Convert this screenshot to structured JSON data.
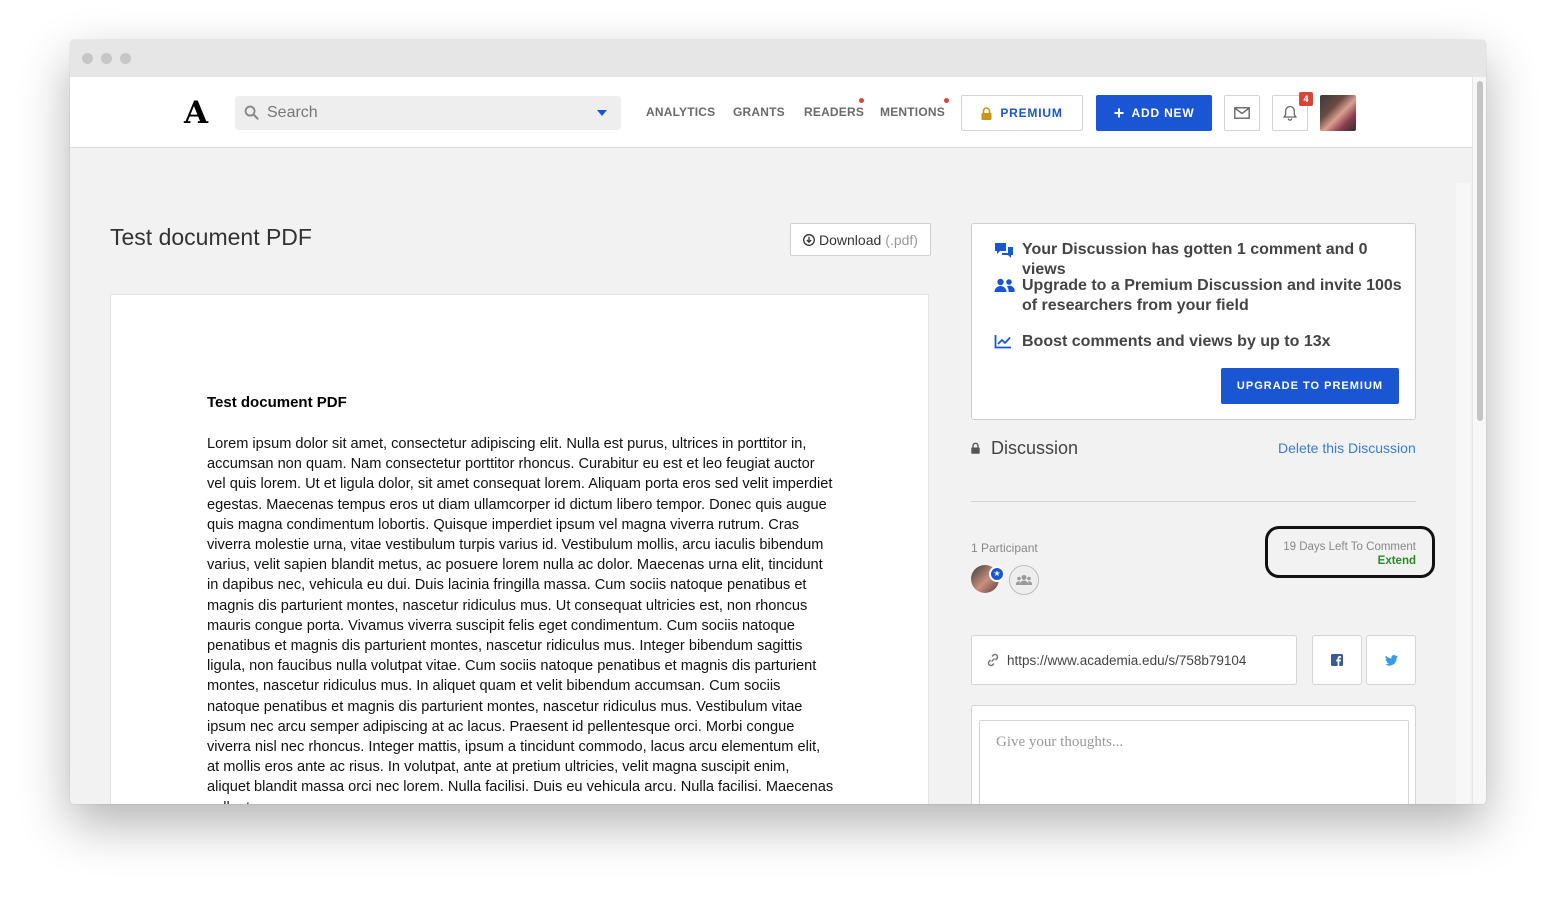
{
  "nav": {
    "logo": "A",
    "search_placeholder": "Search",
    "links": {
      "analytics": "ANALYTICS",
      "grants": "GRANTS",
      "readers": "READERS",
      "mentions": "MENTIONS"
    },
    "premium_label": "PREMIUM",
    "add_new_label": "ADD NEW",
    "notifications_count": "4",
    "accent_color": "#1a56d3",
    "alert_color": "#d6453a"
  },
  "document": {
    "title": "Test document PDF",
    "download_label": "Download",
    "download_ext": "(.pdf)",
    "page_heading": "Test document PDF",
    "page_body": "Lorem ipsum dolor sit amet, consectetur adipiscing elit. Nulla est purus, ultrices in porttitor in, accumsan non quam. Nam consectetur porttitor rhoncus. Curabitur eu est et leo feugiat auctor vel quis lorem. Ut et ligula dolor, sit amet consequat lorem. Aliquam porta eros sed velit imperdiet egestas. Maecenas tempus eros ut diam ullamcorper id dictum libero tempor. Donec quis augue quis magna condimentum lobortis. Quisque imperdiet ipsum vel magna viverra rutrum. Cras viverra molestie urna, vitae vestibulum turpis varius id. Vestibulum mollis, arcu iaculis bibendum varius, velit sapien blandit metus, ac posuere lorem nulla ac dolor. Maecenas urna elit, tincidunt in dapibus nec, vehicula eu dui. Duis lacinia fringilla massa. Cum sociis natoque penatibus et magnis dis parturient montes, nascetur ridiculus mus. Ut consequat ultricies est, non rhoncus mauris congue porta. Vivamus viverra suscipit felis eget condimentum. Cum sociis natoque penatibus et magnis dis parturient montes, nascetur ridiculus mus. Integer bibendum sagittis ligula, non faucibus nulla volutpat vitae. Cum sociis natoque penatibus et magnis dis parturient montes, nascetur ridiculus mus. In aliquet quam et velit bibendum accumsan. Cum sociis natoque penatibus et magnis dis parturient montes, nascetur ridiculus mus. Vestibulum vitae ipsum nec arcu semper adipiscing at ac lacus. Praesent id pellentesque orci. Morbi congue viverra nisl nec rhoncus. Integer mattis, ipsum a tincidunt commodo, lacus arcu elementum elit, at mollis eros ante ac risus. In volutpat, ante at pretium ultricies, velit magna suscipit enim, aliquet blandit massa orci nec lorem. Nulla facilisi. Duis eu vehicula arcu. Nulla facilisi. Maecenas pellentesque"
  },
  "promo": {
    "line1": "Your Discussion has gotten 1 comment and 0 views",
    "line2": "Upgrade to a Premium Discussion and invite 100s of researchers from your field",
    "line3": "Boost comments and views by up to 13x",
    "upgrade_label": "UPGRADE TO PREMIUM"
  },
  "discussion": {
    "title": "Discussion",
    "delete_label": "Delete this Discussion",
    "participants_label": "1 Participant",
    "days_left": "19 Days Left To Comment",
    "extend_label": "Extend",
    "share_url": "https://www.academia.edu/s/758b79104",
    "comment_placeholder": "Give your thoughts..."
  }
}
